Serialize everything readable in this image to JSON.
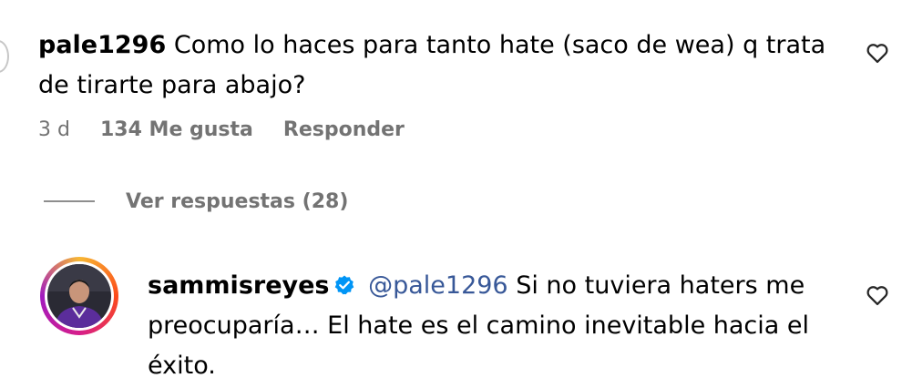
{
  "comment": {
    "username": "pale1296",
    "text": "Como lo haces para tanto hate (saco de wea) q trata de tirarte para abajo?",
    "time": "3 d",
    "likes": "134 Me gusta",
    "reply_label": "Responder"
  },
  "view_replies": {
    "label": "Ver respuestas (28)"
  },
  "reply": {
    "username": "sammisreyes",
    "mention": "@pale1296",
    "text": "Si no tuviera haters me preocuparía… El hate es el camino inevitable hacia el éxito."
  },
  "colors": {
    "text": "#000000",
    "meta": "#737373",
    "mention": "#385898",
    "verified": "#0095f6"
  },
  "icons": {
    "like": "heart-outline-icon",
    "verified": "verified-badge-icon"
  }
}
